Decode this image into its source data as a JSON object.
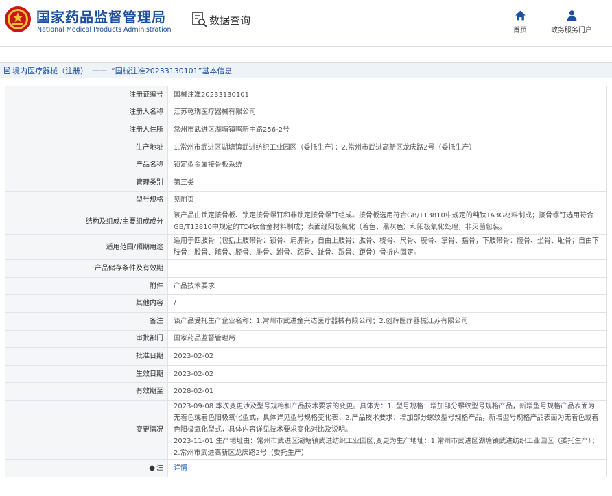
{
  "brand": {
    "title_cn": "国家药品监督管理局",
    "title_en": "National Medical Products Administration"
  },
  "header": {
    "query_label": "数据查询",
    "nav_home": "首页",
    "nav_portal": "政务服务门户"
  },
  "breadcrumb": {
    "category": "境内医疗器械（注册）",
    "separator": "——",
    "current": "“国械注准20233130101”基本信息"
  },
  "colors": {
    "brand_blue": "#1d4fa0",
    "link_blue": "#1d64c2",
    "logo_red": "#c8161d",
    "logo_gold": "#f2c230"
  },
  "rows": [
    {
      "label": "注册证编号",
      "value": "国械注准20233130101"
    },
    {
      "label": "注册人名称",
      "value": "江苏乾瑞医疗器械有限公司"
    },
    {
      "label": "注册人住所",
      "value": "常州市武进区湖塘镇鸣新中路256-2号"
    },
    {
      "label": "生产地址",
      "value": "1.常州市武进区湖塘镇武进纺织工业园区（委托生产）；2.常州市武进高新区龙庆路2号（委托生产）"
    },
    {
      "label": "产品名称",
      "value": "锁定型金属接骨板系统"
    },
    {
      "label": "管理类别",
      "value": "第三类"
    },
    {
      "label": "型号规格",
      "value": "见附页"
    },
    {
      "label": "结构及组成/主要组成成分",
      "value": "该产品由锁定接骨板、锁定接骨螺钉和非锁定接骨螺钉组成。接骨板选用符合GB/T13810中规定的纯钛TA3G材料制成；接骨螺钉选用符合GB/T13810中规定的TC4钛合金材料制成；表面经阳极氧化（着色、黑灰色）和阳极氧化处理，非灭菌包装。"
    },
    {
      "label": "适用范围/预期用途",
      "value": "适用于四肢骨（包括上肢带骨：锁骨、肩胛骨，自由上肢骨：肱骨、桡骨、尺骨、腕骨、掌骨、指骨，下肢带骨：髋骨、坐骨、耻骨；自由下肢骨：股骨、髌骨、胫骨、腓骨、跗骨、跖骨、趾骨、跟骨、距骨）骨折内固定。"
    },
    {
      "label": "产品储存条件及有效期",
      "value": ""
    },
    {
      "label": "附件",
      "value": "产品技术要求"
    },
    {
      "label": "其他内容",
      "value": "/"
    },
    {
      "label": "备注",
      "value": "该产品受托生产企业名称：1.常州市武进金兴达医疗器械有限公司；2.创辉医疗器械江苏有限公司"
    },
    {
      "label": "审批部门",
      "value": "国家药品监督管理局"
    },
    {
      "label": "批准日期",
      "value": "2023-02-02"
    },
    {
      "label": "生效日期",
      "value": "2023-02-02"
    },
    {
      "label": "有效期至",
      "value": "2028-02-01"
    }
  ],
  "change": {
    "label": "变更情况",
    "line1": "2023-09-08 本次变更涉及型号规格和产品技术要求的变更。具体为：1. 型号规格：增加部分螺纹型号规格产品，新增型号规格产品表面为无着色或着色阳极氧化型式，具体详见型号规格变化表；2.产品技术要求：增加部分螺纹型号规格产品，新增型号规格产品表面为无着色或着色阳极氧化型式，具体内容详见技术要求变化对比及说明。",
    "line2": "2023-11-01 生产地址由：常州市武进区湖塘镇武进纺织工业园区;变更为生产地址：1.常州市武进区湖塘镇武进纺织工业园区（委托生产）；2.常州市武进高新区龙庆路2号（委托生产）"
  },
  "note": {
    "label": "注",
    "link": "详情"
  }
}
